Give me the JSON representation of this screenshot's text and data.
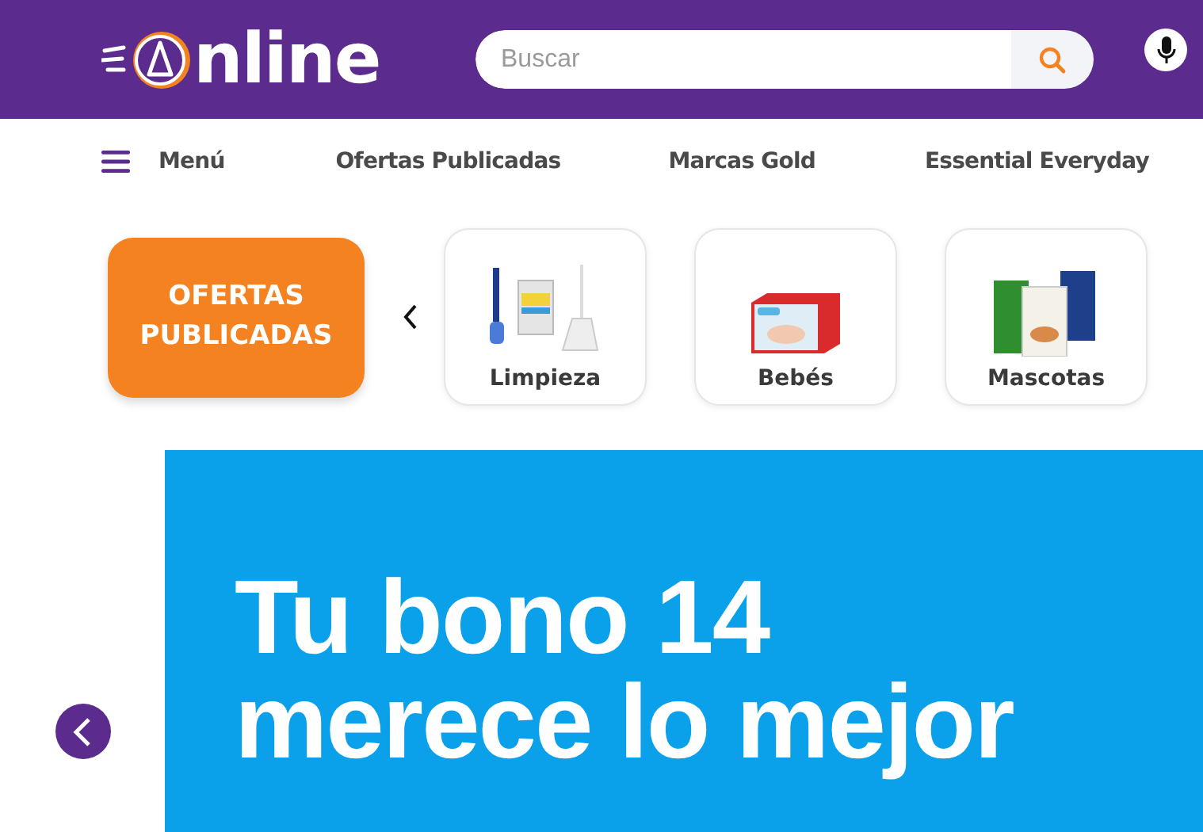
{
  "header": {
    "logo_text": "nline",
    "search": {
      "placeholder": "Buscar"
    }
  },
  "nav": {
    "menu_label": "Menú",
    "links": [
      "Ofertas Publicadas",
      "Marcas Gold",
      "Essential Everyday"
    ]
  },
  "categories": {
    "promo_label": "OFERTAS PUBLICADAS",
    "items": [
      {
        "label": "Limpieza",
        "kind": "cleaning"
      },
      {
        "label": "Bebés",
        "kind": "diapers"
      },
      {
        "label": "Mascotas",
        "kind": "petfood"
      }
    ]
  },
  "banner": {
    "lines": [
      "Tu bono 14",
      "merece lo mejor"
    ]
  }
}
